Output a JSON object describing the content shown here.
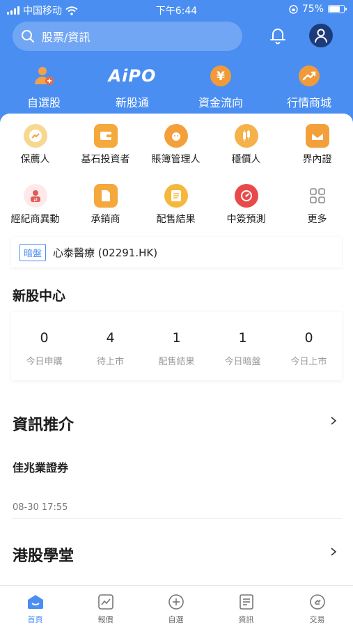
{
  "status": {
    "carrier": "中国移动",
    "time": "下午6:44",
    "battery": "75%",
    "battery_level": 0.75
  },
  "search": {
    "placeholder": "股票/資訊"
  },
  "quick_nav": [
    {
      "label": "自選股",
      "icon": "user-plus-icon"
    },
    {
      "label": "新股通",
      "icon": "aipo-logo"
    },
    {
      "label": "資金流向",
      "icon": "yen-coin-icon"
    },
    {
      "label": "行情商城",
      "icon": "trend-up-icon"
    }
  ],
  "aipo_logo_text": "AiPO",
  "grid": [
    {
      "label": "保薦人",
      "icon": "sponsor-icon",
      "color": "#e9b64c"
    },
    {
      "label": "基石投資者",
      "icon": "wallet-icon",
      "color": "#f0a43a"
    },
    {
      "label": "賬簿管理人",
      "icon": "lion-icon",
      "color": "#f0a43a"
    },
    {
      "label": "穩價人",
      "icon": "candles-icon",
      "color": "#f0a43a"
    },
    {
      "label": "界內證",
      "icon": "envelope-icon",
      "color": "#f0a43a"
    },
    {
      "label": "經紀商異動",
      "icon": "broker-icon",
      "color": "#e05a5a"
    },
    {
      "label": "承銷商",
      "icon": "document-icon",
      "color": "#f0a43a"
    },
    {
      "label": "配售結果",
      "icon": "list-icon",
      "color": "#f0b43a"
    },
    {
      "label": "中簽預測",
      "icon": "gauge-icon",
      "color": "#e04a4a"
    },
    {
      "label": "更多",
      "icon": "grid-icon",
      "color": "#8a8a8a"
    }
  ],
  "ipo_banner": {
    "badge": "暗盤",
    "text": "心泰醫療 (02291.HK)"
  },
  "ipo_center": {
    "title": "新股中心",
    "stats": [
      {
        "value": "0",
        "label": "今日申購"
      },
      {
        "value": "4",
        "label": "待上市"
      },
      {
        "value": "1",
        "label": "配售結果"
      },
      {
        "value": "1",
        "label": "今日暗盤"
      },
      {
        "value": "0",
        "label": "今日上市"
      }
    ]
  },
  "news": {
    "title": "資訊推介",
    "source": "佳兆業證券",
    "time": "08-30 17:55"
  },
  "school": {
    "title": "港股學堂"
  },
  "tabs": [
    {
      "label": "首頁",
      "icon": "home-icon",
      "active": true
    },
    {
      "label": "報價",
      "icon": "chart-icon",
      "active": false
    },
    {
      "label": "自選",
      "icon": "plus-circle-icon",
      "active": false
    },
    {
      "label": "資訊",
      "icon": "news-icon",
      "active": false
    },
    {
      "label": "交易",
      "icon": "trade-icon",
      "active": false
    }
  ]
}
